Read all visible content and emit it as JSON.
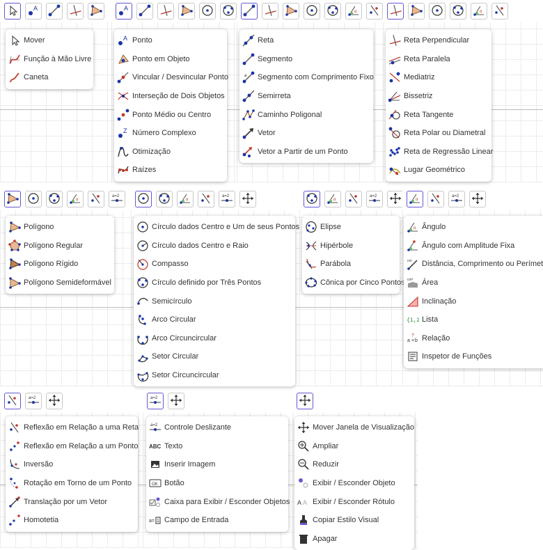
{
  "colors": {
    "accent": "#6557d2",
    "point": "#1a35a6",
    "line": "#555555",
    "red": "#c0392b"
  },
  "panels": [
    {
      "id": "move",
      "toolbar": [
        "move-arrow-icon",
        "point-icon",
        "segment-icon",
        "perpendicular-icon",
        "polygon-icon"
      ],
      "items": [
        {
          "label": "Mover",
          "icon": "move-arrow-icon"
        },
        {
          "label": "Função à Mão Livre",
          "icon": "freehand-function-icon"
        },
        {
          "label": "Caneta",
          "icon": "pen-icon"
        }
      ]
    },
    {
      "id": "point",
      "toolbar": [
        "point-icon",
        "segment-icon",
        "perpendicular-icon",
        "polygon-icon",
        "circle-center-icon",
        "circle-three-points-icon"
      ],
      "items": [
        {
          "label": "Ponto",
          "icon": "point-icon"
        },
        {
          "label": "Ponto em Objeto",
          "icon": "point-on-object-icon"
        },
        {
          "label": "Vincular / Desvincular Ponto",
          "icon": "attach-point-icon"
        },
        {
          "label": "Interseção de Dois Objetos",
          "icon": "intersect-icon"
        },
        {
          "label": "Ponto Médio ou Centro",
          "icon": "midpoint-icon"
        },
        {
          "label": "Número Complexo",
          "icon": "complex-number-icon"
        },
        {
          "label": "Otimização",
          "icon": "optimization-icon"
        },
        {
          "label": "Raízes",
          "icon": "roots-icon"
        }
      ]
    },
    {
      "id": "line",
      "toolbar": [
        "segment-icon",
        "perpendicular-icon",
        "polygon-icon",
        "circle-center-icon",
        "circle-three-points-icon",
        "angle-icon",
        "reflect-icon"
      ],
      "items": [
        {
          "label": "Reta",
          "icon": "line-icon"
        },
        {
          "label": "Segmento",
          "icon": "segment-icon"
        },
        {
          "label": "Segmento com Comprimento Fixo",
          "icon": "segment-fixed-icon"
        },
        {
          "label": "Semirreta",
          "icon": "ray-icon"
        },
        {
          "label": "Caminho Poligonal",
          "icon": "polyline-icon"
        },
        {
          "label": "Vetor",
          "icon": "vector-icon"
        },
        {
          "label": "Vetor a Partir de um Ponto",
          "icon": "vector-from-point-icon"
        }
      ]
    },
    {
      "id": "perp",
      "toolbar": [
        "perpendicular-icon",
        "polygon-icon",
        "circle-center-icon",
        "circle-three-points-icon",
        "angle-icon",
        "reflect-icon"
      ],
      "items": [
        {
          "label": "Reta Perpendicular",
          "icon": "perpendicular-icon"
        },
        {
          "label": "Reta Paralela",
          "icon": "parallel-icon"
        },
        {
          "label": "Mediatriz",
          "icon": "bisector-icon"
        },
        {
          "label": "Bissetriz",
          "icon": "angle-bisector-icon"
        },
        {
          "label": "Reta Tangente",
          "icon": "tangent-icon"
        },
        {
          "label": "Reta Polar ou Diametral",
          "icon": "polar-icon"
        },
        {
          "label": "Reta de Regressão Linear",
          "icon": "regression-icon"
        },
        {
          "label": "Lugar Geométrico",
          "icon": "locus-icon"
        }
      ]
    },
    {
      "id": "polygon",
      "toolbar": [
        "polygon-icon",
        "circle-center-icon",
        "circle-three-points-icon",
        "angle-icon",
        "reflect-icon",
        "slider-icon"
      ],
      "items": [
        {
          "label": "Polígono",
          "icon": "polygon-icon"
        },
        {
          "label": "Polígono Regular",
          "icon": "regular-polygon-icon"
        },
        {
          "label": "Polígono Rígido",
          "icon": "rigid-polygon-icon"
        },
        {
          "label": "Polígono Semideformável",
          "icon": "vector-polygon-icon"
        }
      ]
    },
    {
      "id": "circle",
      "toolbar": [
        "circle-center-icon",
        "circle-three-points-icon",
        "angle-icon",
        "reflect-icon",
        "slider-icon",
        "move-view-icon"
      ],
      "items": [
        {
          "label": "Círculo dados Centro e Um de seus Pontos",
          "icon": "circle-center-icon"
        },
        {
          "label": "Círculo dados Centro e Raio",
          "icon": "circle-radius-icon"
        },
        {
          "label": "Compasso",
          "icon": "compass-icon"
        },
        {
          "label": "Círculo definido por Três Pontos",
          "icon": "circle-three-points-icon"
        },
        {
          "label": "Semicírculo",
          "icon": "semicircle-icon"
        },
        {
          "label": "Arco Circular",
          "icon": "arc-icon"
        },
        {
          "label": "Arco Circuncircular",
          "icon": "circumarc-icon"
        },
        {
          "label": "Setor Circular",
          "icon": "sector-icon"
        },
        {
          "label": "Setor Circuncircular",
          "icon": "circumsector-icon"
        }
      ]
    },
    {
      "id": "conic",
      "toolbar": [
        "circle-three-points-icon",
        "angle-icon",
        "reflect-icon",
        "slider-icon",
        "move-view-icon"
      ],
      "items": [
        {
          "label": "Elipse",
          "icon": "ellipse-icon"
        },
        {
          "label": "Hipérbole",
          "icon": "hyperbola-icon"
        },
        {
          "label": "Parábola",
          "icon": "parabola-icon"
        },
        {
          "label": "Cônica por Cinco Pontos",
          "icon": "conic-five-points-icon"
        }
      ]
    },
    {
      "id": "angle",
      "toolbar": [
        "angle-icon",
        "reflect-icon",
        "slider-icon",
        "move-view-icon"
      ],
      "items": [
        {
          "label": "Ângulo",
          "icon": "angle-icon"
        },
        {
          "label": "Ângulo com Amplitude Fixa",
          "icon": "angle-fixed-icon"
        },
        {
          "label": "Distância, Comprimento ou Perímetro",
          "icon": "distance-icon"
        },
        {
          "label": "Área",
          "icon": "area-icon"
        },
        {
          "label": "Inclinação",
          "icon": "slope-icon"
        },
        {
          "label": "Lista",
          "icon": "list-icon"
        },
        {
          "label": "Relação",
          "icon": "relation-icon"
        },
        {
          "label": "Inspetor de Funções",
          "icon": "function-inspector-icon"
        }
      ]
    },
    {
      "id": "reflect",
      "toolbar": [
        "reflect-icon",
        "slider-icon",
        "move-view-icon"
      ],
      "items": [
        {
          "label": "Reflexão em Relação a uma Reta",
          "icon": "reflect-icon"
        },
        {
          "label": "Reflexão em Relação a um Ponto",
          "icon": "reflect-point-icon"
        },
        {
          "label": "Inversão",
          "icon": "inversion-icon"
        },
        {
          "label": "Rotação em Torno de um Ponto",
          "icon": "rotate-icon"
        },
        {
          "label": "Translação por um Vetor",
          "icon": "translate-icon"
        },
        {
          "label": "Homotetia",
          "icon": "dilate-icon"
        }
      ]
    },
    {
      "id": "slider",
      "toolbar": [
        "slider-icon",
        "move-view-icon"
      ],
      "items": [
        {
          "label": "Controle Deslizante",
          "icon": "slider-icon"
        },
        {
          "label": "Texto",
          "icon": "text-icon"
        },
        {
          "label": "Inserir Imagem",
          "icon": "image-icon"
        },
        {
          "label": "Botão",
          "icon": "button-icon"
        },
        {
          "label": "Caixa para Exibir / Esconder Objetos",
          "icon": "checkbox-icon"
        },
        {
          "label": "Campo de Entrada",
          "icon": "input-box-icon"
        }
      ]
    },
    {
      "id": "view",
      "toolbar": [
        "move-view-icon"
      ],
      "items": [
        {
          "label": "Mover Janela de Visualização",
          "icon": "move-view-icon"
        },
        {
          "label": "Ampliar",
          "icon": "zoom-in-icon"
        },
        {
          "label": "Reduzir",
          "icon": "zoom-out-icon"
        },
        {
          "label": "Exibir / Esconder Objeto",
          "icon": "show-hide-object-icon"
        },
        {
          "label": "Exibir / Esconder Rótulo",
          "icon": "show-hide-label-icon"
        },
        {
          "label": "Copiar Estilo Visual",
          "icon": "copy-style-icon"
        },
        {
          "label": "Apagar",
          "icon": "delete-icon"
        }
      ]
    }
  ]
}
